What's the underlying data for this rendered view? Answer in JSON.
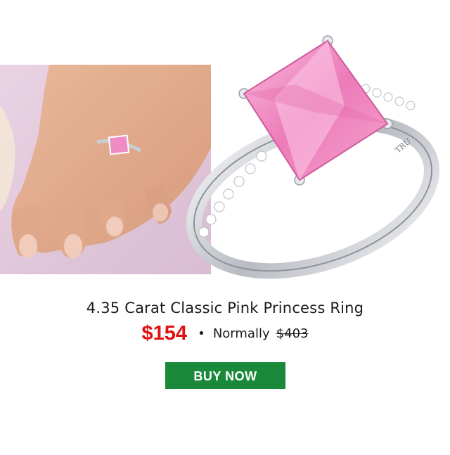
{
  "product": {
    "title": "4.35 Carat Classic Pink Princess Ring",
    "price_now": "$154",
    "separator": "•",
    "normally_label": "Normally",
    "price_was": "$403"
  },
  "cta": {
    "label": "BUY NOW"
  },
  "images": {
    "hand_photo": "hand-wearing-ring-photo",
    "ring_photo": "pink-princess-ring-photo",
    "band_engraving": "TRU"
  },
  "colors": {
    "price_accent": "#e01010",
    "button_bg": "#1a8a3a",
    "gem_pink": "#f08cc4"
  }
}
